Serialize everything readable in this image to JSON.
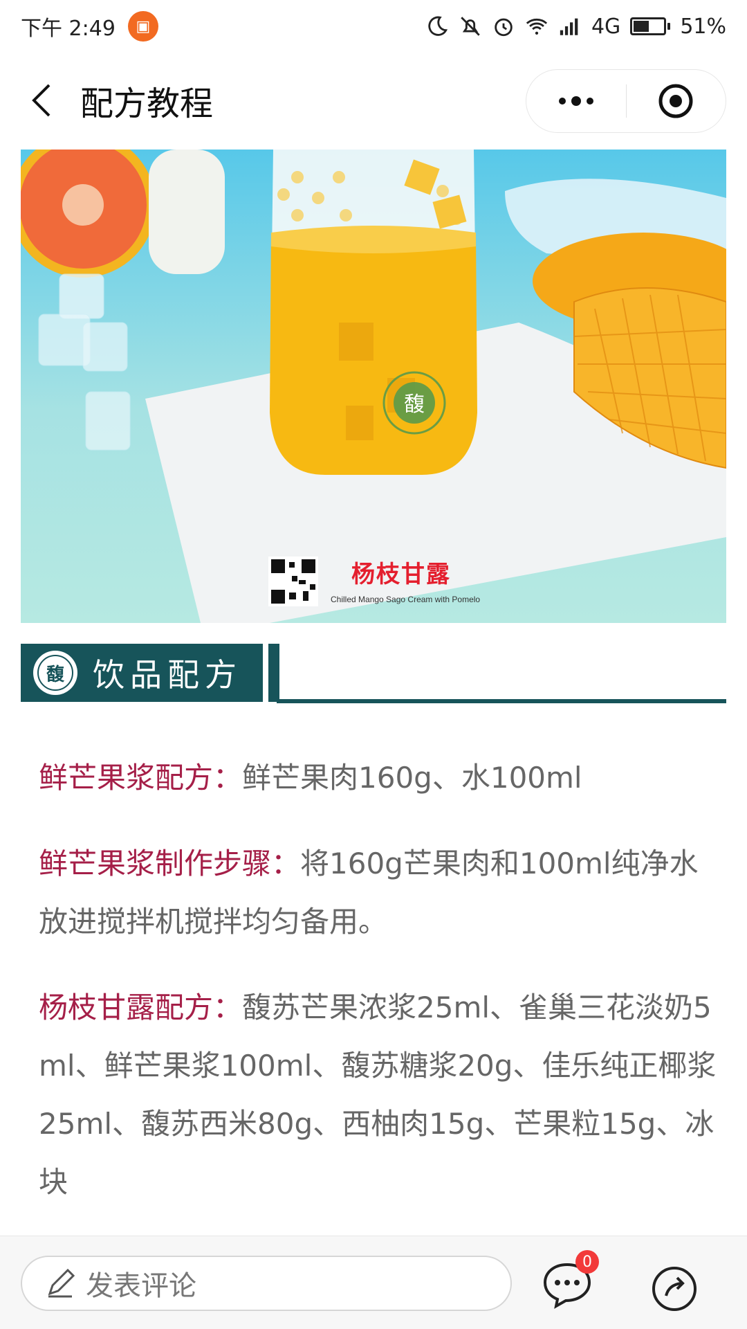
{
  "status_bar": {
    "time": "下午 2:49",
    "network": "4G",
    "battery_percent": "51%",
    "battery_level": 0.51
  },
  "nav": {
    "title": "配方教程"
  },
  "hero": {
    "title": "杨枝甘露",
    "subtitle": "Chilled Mango Sago Cream with Pomelo",
    "logo_glyph": "馥"
  },
  "section": {
    "title": "饮品配方",
    "logo_glyph": "馥"
  },
  "recipe": [
    {
      "label": "鲜芒果浆配方：",
      "text": "鲜芒果肉160g、水100ml"
    },
    {
      "label": "鲜芒果浆制作步骤：",
      "text": "将160g芒果肉和100ml纯净水放进搅拌机搅拌均匀备用。"
    },
    {
      "label": "杨枝甘露配方：",
      "text": "馥苏芒果浓浆25ml、雀巢三花淡奶5ml、鲜芒果浆100ml、馥苏糖浆20g、佳乐纯正椰浆25ml、馥苏西米80g、西柚肉15g、芒果粒15g、冰块"
    }
  ],
  "comment_bar": {
    "placeholder": "发表评论",
    "comment_count": "0"
  },
  "colors": {
    "label": "#a51f48",
    "section": "#17545a",
    "body_text": "#666666",
    "badge": "#f23a3a"
  }
}
